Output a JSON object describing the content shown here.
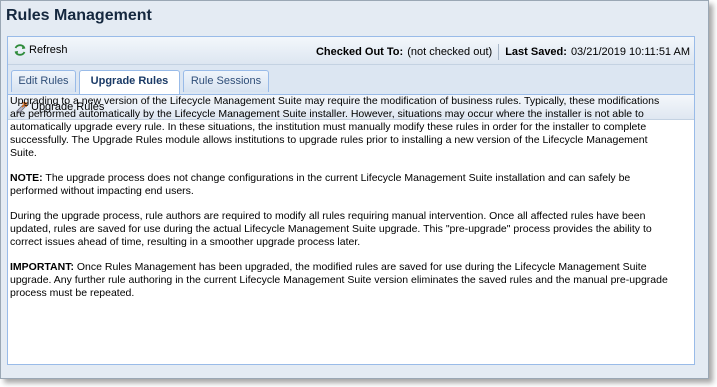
{
  "window": {
    "title": "Rules Management"
  },
  "toolbar": {
    "refresh_label": "Refresh",
    "checked_out_label": "Checked Out To:",
    "checked_out_value": "(not checked out)",
    "last_saved_label": "Last Saved:",
    "last_saved_value": "03/21/2019 10:11:51 AM"
  },
  "tabs": [
    {
      "label": "Edit Rules"
    },
    {
      "label": "Upgrade Rules"
    },
    {
      "label": "Rule Sessions"
    }
  ],
  "subheader": {
    "label": "Upgrade Rules"
  },
  "content": {
    "p1": "Upgrading to a new version of the Lifecycle Management Suite may require the modification of business rules. Typically, these modifications are performed automatically by the Lifecycle Management Suite installer. However, situations may occur where the installer is not able to automatically upgrade every rule. In these situations, the institution must manually modify these rules in order for the installer to complete successfully. The Upgrade Rules module allows institutions to upgrade rules prior to installing a new version of the Lifecycle Management Suite.",
    "note_label": "NOTE:",
    "note_text": " The upgrade process does not change configurations in the current Lifecycle Management Suite installation and can safely be performed without impacting end users.",
    "p3": "During the upgrade process, rule authors are required to modify all rules requiring manual intervention. Once all affected rules have been updated, rules are saved for use during the actual Lifecycle Management Suite upgrade. This \"pre-upgrade\" process provides the ability to correct issues ahead of time, resulting in a smoother upgrade process later.",
    "important_label": "IMPORTANT:",
    "important_text": " Once Rules Management has been upgraded, the modified rules are saved for use during the Lifecycle Management Suite upgrade. Any further rule authoring in the current Lifecycle Management Suite version eliminates the saved rules and the manual pre-upgrade process must be repeated."
  },
  "colors": {
    "accent": "#99bbe8",
    "title": "#15283f",
    "tab_text": "#2f4e78"
  },
  "icons": {
    "refresh": "refresh-icon",
    "upgrade": "upgrade-rules-icon"
  }
}
